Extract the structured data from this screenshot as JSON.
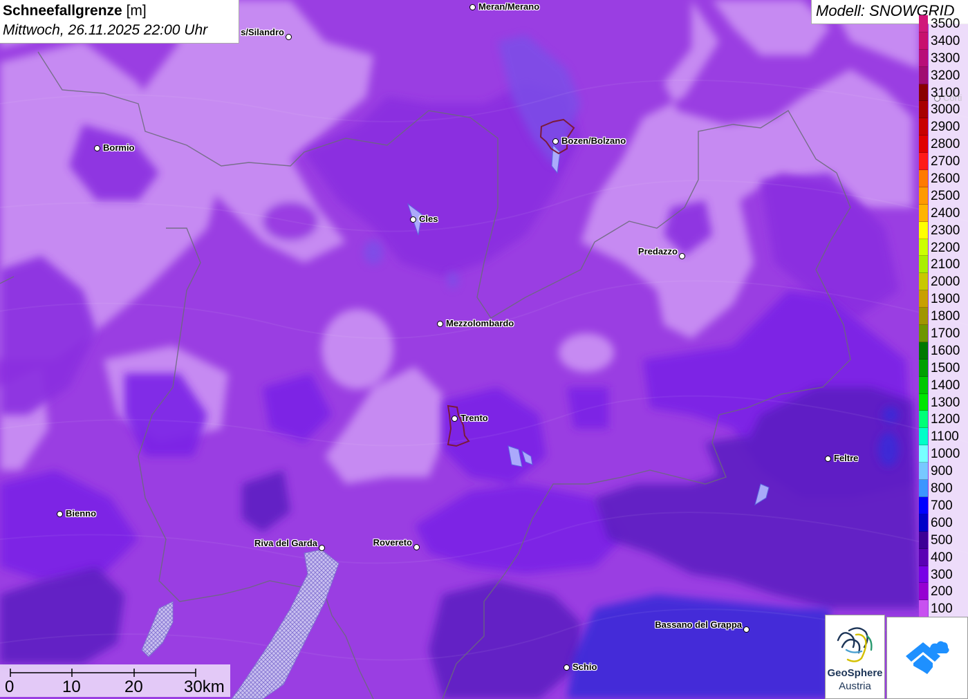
{
  "title": {
    "name": "Schneefallgrenze",
    "unit": "[m]",
    "datetime": "Mittwoch, 26.11.2025 22:00 Uhr"
  },
  "model": "Modell: SNOWGRID",
  "legend": [
    {
      "label": "3500",
      "color": "#d0187a"
    },
    {
      "label": "3400",
      "color": "#c8106e"
    },
    {
      "label": "3300",
      "color": "#b80e78"
    },
    {
      "label": "3200",
      "color": "#a00c70"
    },
    {
      "label": "3100",
      "color": "#8a0000"
    },
    {
      "label": "3000",
      "color": "#a80000"
    },
    {
      "label": "2900",
      "color": "#c80000"
    },
    {
      "label": "2800",
      "color": "#e00000"
    },
    {
      "label": "2700",
      "color": "#ff1a1a"
    },
    {
      "label": "2600",
      "color": "#ff7a00"
    },
    {
      "label": "2500",
      "color": "#ff9a00"
    },
    {
      "label": "2400",
      "color": "#ffb400"
    },
    {
      "label": "2300",
      "color": "#ffff00"
    },
    {
      "label": "2200",
      "color": "#ccff00"
    },
    {
      "label": "2100",
      "color": "#aaee00"
    },
    {
      "label": "2000",
      "color": "#c8c800"
    },
    {
      "label": "1900",
      "color": "#c8a000"
    },
    {
      "label": "1800",
      "color": "#a09600"
    },
    {
      "label": "1700",
      "color": "#6e9600"
    },
    {
      "label": "1600",
      "color": "#007800"
    },
    {
      "label": "1500",
      "color": "#00a000"
    },
    {
      "label": "1400",
      "color": "#00c800"
    },
    {
      "label": "1300",
      "color": "#00e600"
    },
    {
      "label": "1200",
      "color": "#00ff78"
    },
    {
      "label": "1100",
      "color": "#00ffc8"
    },
    {
      "label": "1000",
      "color": "#78ffff"
    },
    {
      "label": "900",
      "color": "#78c8ff"
    },
    {
      "label": "800",
      "color": "#3c96ff"
    },
    {
      "label": "700",
      "color": "#0000ff"
    },
    {
      "label": "600",
      "color": "#0000c8"
    },
    {
      "label": "500",
      "color": "#3c0096"
    },
    {
      "label": "400",
      "color": "#5a00b4"
    },
    {
      "label": "300",
      "color": "#7800e6"
    },
    {
      "label": "200",
      "color": "#9600d2"
    },
    {
      "label": "100",
      "color": "#c850f0"
    }
  ],
  "cities": [
    {
      "name": "Meran/Merano",
      "anchor": "left"
    },
    {
      "name": "s/Silandro",
      "anchor": "right"
    },
    {
      "name": "Bormio",
      "anchor": "left"
    },
    {
      "name": "Bozen/Bolzano",
      "anchor": "left"
    },
    {
      "name": "Cles",
      "anchor": "left"
    },
    {
      "name": "Predazzo",
      "anchor": "right"
    },
    {
      "name": "Mezzolombardo",
      "anchor": "left"
    },
    {
      "name": "Trento",
      "anchor": "left"
    },
    {
      "name": "Feltre",
      "anchor": "left"
    },
    {
      "name": "Bienno",
      "anchor": "left"
    },
    {
      "name": "Riva del Garda",
      "anchor": "right"
    },
    {
      "name": "Rovereto",
      "anchor": "right"
    },
    {
      "name": "Bassano del Grappa",
      "anchor": "right"
    },
    {
      "name": "Schio",
      "anchor": "left"
    },
    {
      "name": "Corti",
      "anchor": "left"
    }
  ],
  "scale": {
    "labels": [
      "0",
      "10",
      "20",
      "30km"
    ]
  },
  "logo": {
    "line1": "GeoSphere",
    "line2": "Austria"
  }
}
